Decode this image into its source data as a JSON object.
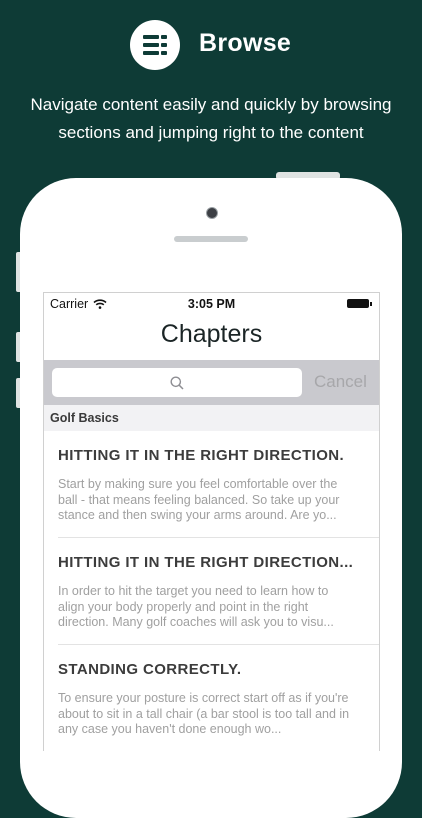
{
  "header": {
    "headline": "Browse",
    "badge_icon": "list-icon",
    "tagline_line1": "Navigate content easily and quickly by browsing",
    "tagline_line2": "sections and jumping right to the content"
  },
  "status_bar": {
    "carrier": "Carrier",
    "time": "3:05 PM"
  },
  "nav": {
    "title": "Chapters"
  },
  "search": {
    "placeholder": "",
    "cancel_label": "Cancel"
  },
  "section": {
    "title": "Golf Basics"
  },
  "chapters": [
    {
      "title": "HITTING IT IN THE RIGHT DIRECTION.",
      "excerpt": "Start by making sure you feel comfortable over the ball - that means feeling balanced. So take up your stance and then swing your arms around. Are yo..."
    },
    {
      "title": "HITTING IT IN THE RIGHT DIRECTION...",
      "excerpt": "In order to hit the target you need to learn how to align your body properly and point in the right direction. Many golf coaches will ask you to visu..."
    },
    {
      "title": "STANDING CORRECTLY.",
      "excerpt": "To ensure your posture is correct start off as if you're about to sit in a tall chair (a bar stool is too tall and in any case you haven't done enough wo..."
    }
  ],
  "colors": {
    "background": "#0e3b36",
    "search_bar": "#c9c9ce",
    "excerpt_text": "#a0a0a0"
  }
}
